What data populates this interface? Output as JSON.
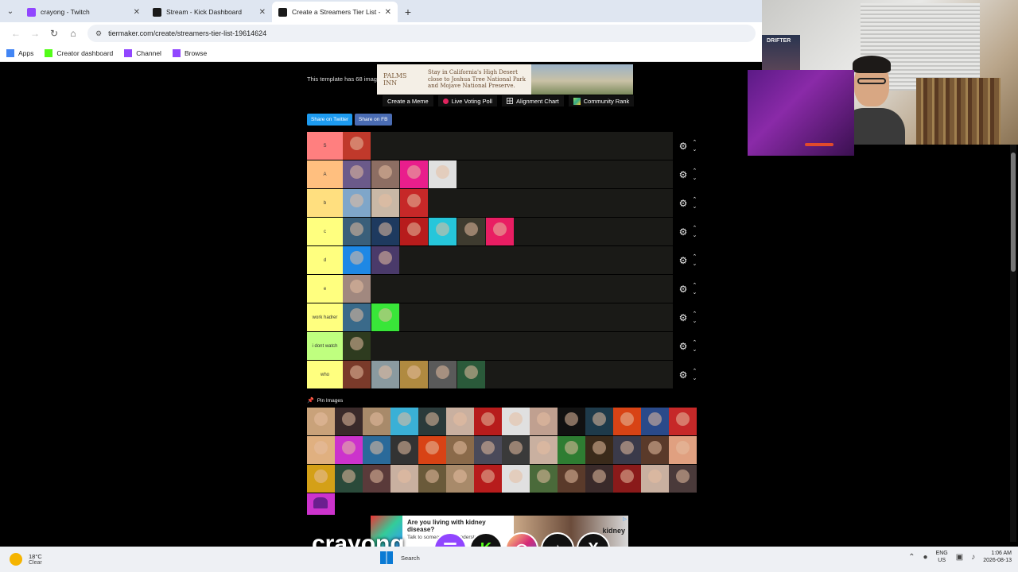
{
  "browser": {
    "tabs": [
      {
        "title": "crayong - Twitch",
        "fav_color": "#9146ff",
        "active": false
      },
      {
        "title": "Stream - Kick Dashboard",
        "fav_color": "#1a1a1a",
        "active": false
      },
      {
        "title": "Create a Streamers Tier List - Ti",
        "fav_color": "#1a1a1a",
        "active": true
      }
    ],
    "url": "tiermaker.com/create/streamers-tier-list-19614624",
    "bookmarks": [
      {
        "label": "Apps",
        "icon": "apps-grid-icon"
      },
      {
        "label": "Creator dashboard",
        "icon": "kick-icon"
      },
      {
        "label": "Channel",
        "icon": "twitch-icon"
      },
      {
        "label": "Browse",
        "icon": "twitch-icon"
      }
    ]
  },
  "page": {
    "template_note": "This template has 68 imag",
    "ad_top": {
      "brand": "PALMS INN",
      "text": "Stay in California's High Desert close to Joshua Tree National Park and Mojave National Preserve."
    },
    "actions": [
      "Create a Meme",
      "Live Voting Poll",
      "Alignment Chart",
      "Community Rank"
    ],
    "share": {
      "twitter": "Share on Twitter",
      "facebook": "Share on FB"
    },
    "tiers": [
      {
        "label": "S",
        "color": "#ff7f7f",
        "items": [
          "#c0392b"
        ]
      },
      {
        "label": "A",
        "color": "#ffbf7f",
        "items": [
          "#6b5a8a",
          "#8d6e63",
          "#e91e8c",
          "#e0e0e0"
        ]
      },
      {
        "label": "b",
        "color": "#ffdf7f",
        "items": [
          "#7fa6c9",
          "#c9b8a6",
          "#c62828"
        ]
      },
      {
        "label": "c",
        "color": "#ffff7f",
        "items": [
          "#3a5f7a",
          "#1e3a5f",
          "#b71c1c",
          "#26c6da",
          "#3e3b2f",
          "#e91e63"
        ]
      },
      {
        "label": "d",
        "color": "#ffff7f",
        "items": [
          "#1e88e5",
          "#4a3a6a"
        ]
      },
      {
        "label": "e",
        "color": "#ffff7f",
        "items": [
          "#a1887f"
        ]
      },
      {
        "label": "work hadrer",
        "color": "#ffff7f",
        "items": [
          "#3a6a8a",
          "#39e639"
        ]
      },
      {
        "label": "i dont watch",
        "color": "#bfff7f",
        "items": [
          "#2e3b1f"
        ]
      },
      {
        "label": "who",
        "color": "#ffff7f",
        "items": [
          "#7a3a2a",
          "#8a9aa0",
          "#b08a40",
          "#5a5a5a",
          "#2a5a3a"
        ]
      }
    ],
    "pin_label": "Pin Images",
    "pool": [
      "#c9a27a",
      "#3a2a2a",
      "#a88a6a",
      "#3ab0d6",
      "#2a3a3a",
      "#c9b0a0",
      "#b71c1c",
      "#e0e0e0",
      "#c0a090",
      "#111111",
      "#1e3a4a",
      "#d84315",
      "#2a4a8a",
      "#c62828",
      "#e0b080",
      "#cc33cc",
      "#2a6a9a",
      "#333333",
      "#d84315",
      "#8a6a4a",
      "#4a4a5a",
      "#3a3a3a",
      "#c9b0a0",
      "#2e7d32",
      "#3a2a1a",
      "#3a3a4a",
      "#5a3a2a",
      "#e0a080",
      "#d4a017",
      "#2a4a3a",
      "#5a3a3a",
      "#c9b0a0",
      "#6a5a3a",
      "#a88a6a",
      "#b71c1c",
      "#e0e0e0",
      "#4a6a3a",
      "#5a3a2a",
      "#3a2a2a",
      "#8a1a1a",
      "#c9b0a0",
      "#4a3a3a"
    ]
  },
  "stream": {
    "poster_text": "DRIFTER",
    "overlay_name": "crayong",
    "socials": [
      {
        "name": "twitch-icon",
        "glyph": "☰"
      },
      {
        "name": "kick-icon",
        "glyph": "K"
      },
      {
        "name": "instagram-icon",
        "glyph": "◎"
      },
      {
        "name": "tiktok-icon",
        "glyph": "♪"
      },
      {
        "name": "x-icon",
        "glyph": "X"
      }
    ]
  },
  "ad_bottom": {
    "headline": "Are you living with kidney disease?",
    "sub": "Talk to someone who understands you.",
    "brand": "kidney"
  },
  "taskbar": {
    "temp": "18°C",
    "cond": "Clear",
    "search": "Search",
    "lang1": "ENG",
    "lang2": "US",
    "time": "1:06 AM",
    "date": "2026-08-13"
  }
}
